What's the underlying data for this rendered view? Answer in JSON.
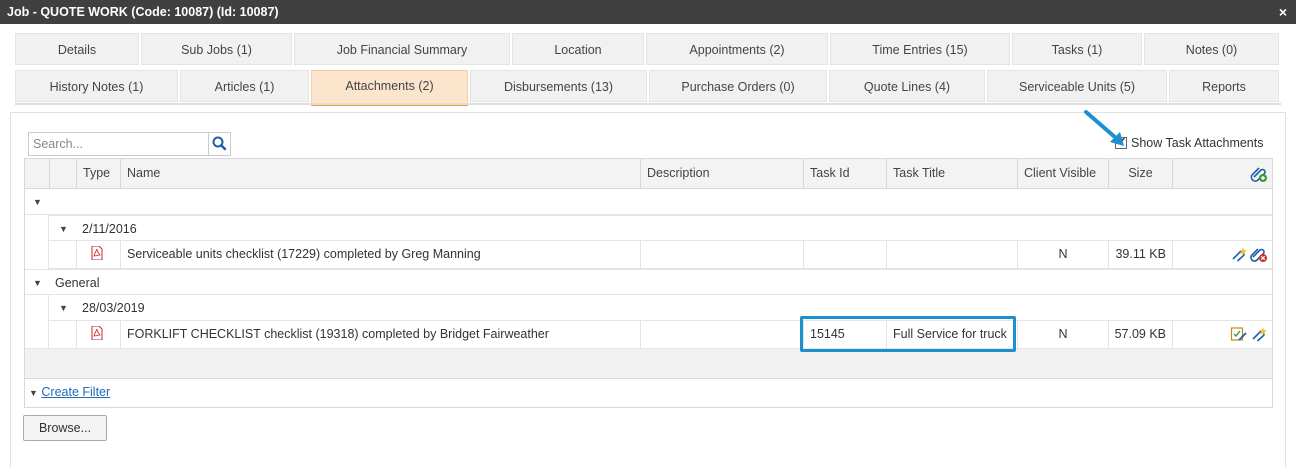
{
  "window": {
    "title": "Job - QUOTE WORK (Code: 10087) (Id: 10087)",
    "close_glyph": "×"
  },
  "tabs_row1": [
    {
      "label": "Details"
    },
    {
      "label": "Sub Jobs (1)"
    },
    {
      "label": "Job Financial Summary"
    },
    {
      "label": "Location"
    },
    {
      "label": "Appointments (2)"
    },
    {
      "label": "Time Entries (15)"
    },
    {
      "label": "Tasks (1)"
    },
    {
      "label": "Notes (0)"
    }
  ],
  "tabs_row2": [
    {
      "label": "History Notes (1)"
    },
    {
      "label": "Articles (1)"
    },
    {
      "label": "Attachments (2)",
      "active": true
    },
    {
      "label": "Disbursements (13)"
    },
    {
      "label": "Purchase Orders (0)"
    },
    {
      "label": "Quote Lines (4)"
    },
    {
      "label": "Serviceable Units (5)"
    },
    {
      "label": "Reports"
    }
  ],
  "search": {
    "placeholder": "Search...",
    "icon": "search-icon"
  },
  "show_task_attachments": {
    "label": "Show Task Attachments",
    "checked": true
  },
  "grid": {
    "columns": [
      "Type",
      "Name",
      "Description",
      "Task Id",
      "Task Title",
      "Client Visible",
      "Size"
    ],
    "groups": [
      {
        "label": "",
        "subgroups": [
          {
            "label": "2/11/2016",
            "rows": [
              {
                "type_icon": "pdf-icon",
                "name": "Serviceable units checklist (17229) completed by Greg Manning",
                "description": "",
                "task_id": "",
                "task_title": "",
                "client_visible": "N",
                "size": "39.11 KB"
              }
            ]
          }
        ]
      },
      {
        "label": "General",
        "subgroups": [
          {
            "label": "28/03/2019",
            "rows": [
              {
                "type_icon": "pdf-icon",
                "name": "FORKLIFT CHECKLIST checklist (19318) completed by Bridget Fairweather",
                "description": "",
                "task_id": "15145",
                "task_title": "Full Service for truck",
                "client_visible": "N",
                "size": "57.09 KB"
              }
            ]
          }
        ]
      }
    ]
  },
  "filter": {
    "label": "Create Filter"
  },
  "browse": {
    "label": "Browse..."
  },
  "colors": {
    "accent_tab": "#f39c34",
    "highlight": "#1c8fd0",
    "link": "#1e6bb8"
  }
}
